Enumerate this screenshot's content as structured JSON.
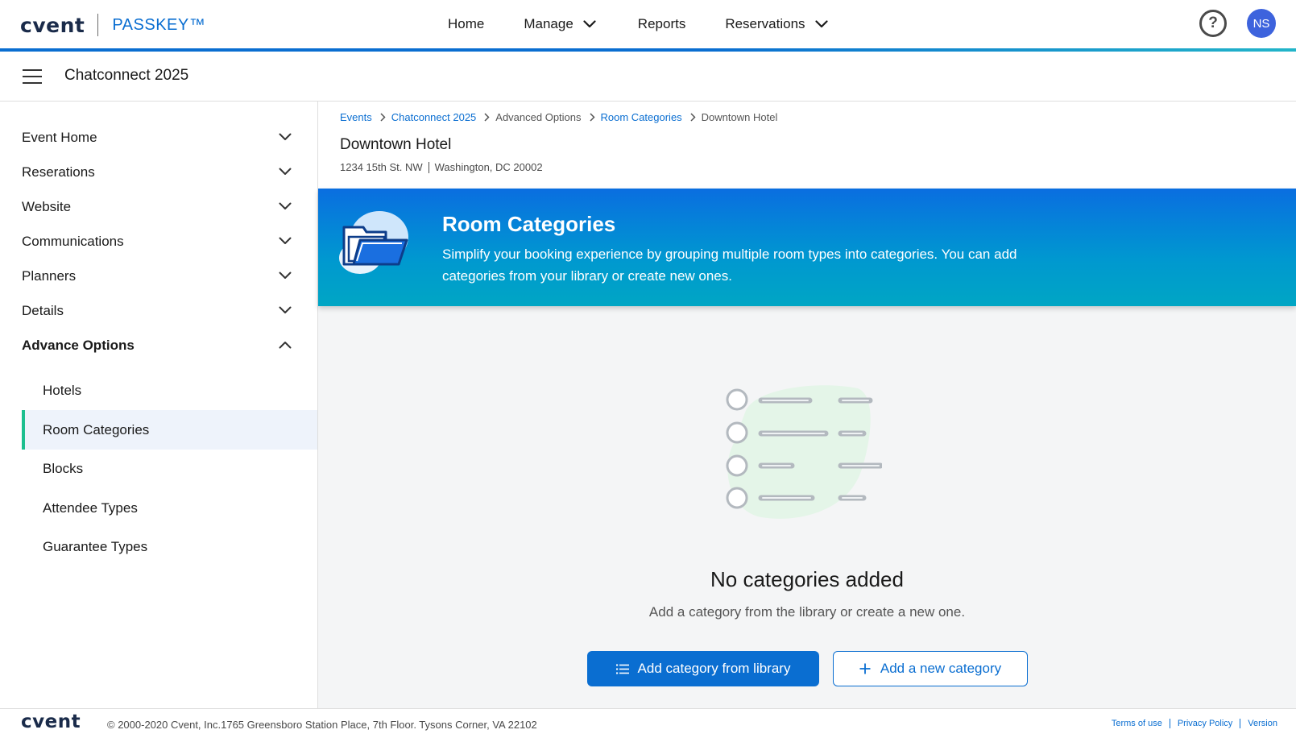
{
  "topnav": {
    "logo": "cvent",
    "product": "PASSKEY™",
    "links": [
      {
        "label": "Home"
      },
      {
        "label": "Manage"
      },
      {
        "label": "Reports"
      },
      {
        "label": "Reservations"
      }
    ],
    "help_icon": "help-circle-icon",
    "avatar_initials": "NS"
  },
  "event": {
    "title": "Chatconnect 2025"
  },
  "sidebar": {
    "items": [
      {
        "label": "Event Home",
        "expanded": false
      },
      {
        "label": "Reserations",
        "expanded": false
      },
      {
        "label": "Website",
        "expanded": false
      },
      {
        "label": "Communications",
        "expanded": false
      },
      {
        "label": "Planners",
        "expanded": false
      },
      {
        "label": "Details",
        "expanded": false
      },
      {
        "label": "Advance Options",
        "expanded": true
      }
    ],
    "subitems": [
      {
        "label": "Hotels"
      },
      {
        "label": "Room Categories",
        "active": true
      },
      {
        "label": "Blocks"
      },
      {
        "label": "Attendee Types"
      },
      {
        "label": "Guarantee Types"
      }
    ]
  },
  "breadcrumb": [
    {
      "label": "Events",
      "link": true
    },
    {
      "label": "Chatconnect 2025",
      "link": true
    },
    {
      "label": "Advanced Options",
      "link": false
    },
    {
      "label": "Room Categories",
      "link": true
    },
    {
      "label": "Downtown Hotel",
      "link": false
    }
  ],
  "hotel": {
    "name": "Downtown Hotel",
    "street": "1234 15th St. NW",
    "city": "Washington, DC 20002"
  },
  "banner": {
    "title": "Room Categories",
    "description": "Simplify your booking experience by grouping multiple room types into categories. You can add categories from your library or create new ones.",
    "icon": "folder-icon"
  },
  "empty_state": {
    "title": "No categories added",
    "subtitle": "Add a category from the library or create a new one.",
    "illustration": "empty-list-icon",
    "primary_button": "Add category from library",
    "secondary_button": "Add a new category"
  },
  "footer": {
    "logo": "cvent",
    "copyright": "© 2000-2020 Cvent, Inc.1765 Greensboro Station Place, 7th Floor. Tysons Corner, VA 22102",
    "links": [
      "Terms of use",
      "Privacy Policy",
      "Version"
    ]
  },
  "colors": {
    "primary": "#0a6ed1",
    "accent_green": "#1dbf8f",
    "avatar": "#3d63dd",
    "banner_top": "#0a6ee0",
    "banner_bottom": "#00a6c4"
  }
}
